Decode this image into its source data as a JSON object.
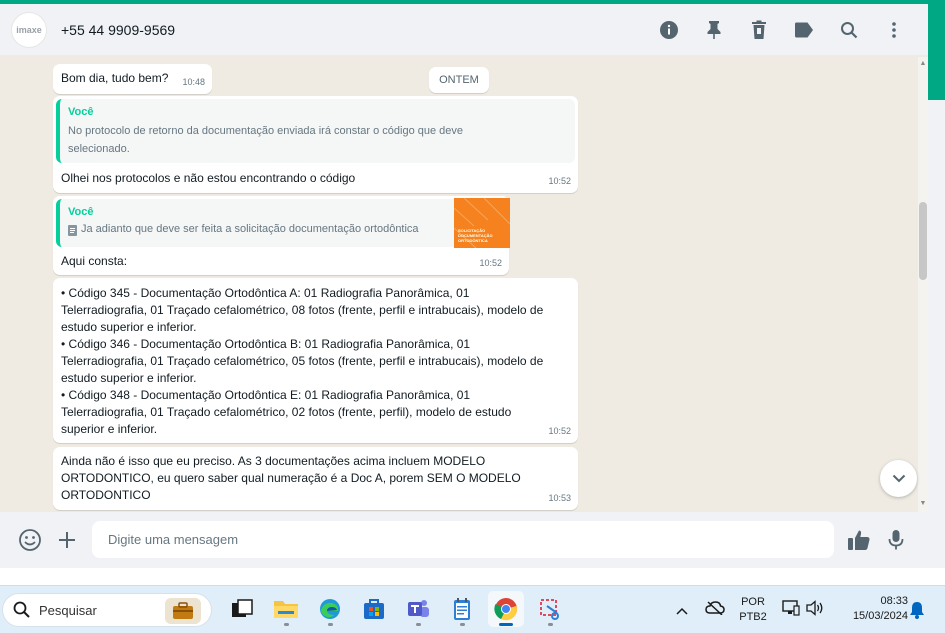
{
  "header": {
    "avatar_text": "imaxe",
    "contact": "+55 44 9909-9569",
    "icons": [
      "info-icon",
      "pin-icon",
      "delete-icon",
      "label-icon",
      "search-icon",
      "menu-icon"
    ]
  },
  "chat": {
    "date_chip": "ONTEM",
    "messages": [
      {
        "text": "Bom dia, tudo bem?",
        "time": "10:48"
      },
      {
        "quote_author": "Você",
        "quote_text_1": "No protocolo de retorno da documentação enviada irá constar o código que deve",
        "quote_text_2": "selecionado.",
        "text": "Olhei nos protocolos e não estou encontrando o código",
        "time": "10:52"
      },
      {
        "quote_author": "Você",
        "quote_text": "Ja adianto que deve ser feita a solicitação documentação ortodôntica",
        "thumb_text": "SOLICITAÇÃO DOCUMENTAÇÃO ORTODÔNTICA",
        "text": "Aqui consta:",
        "time": "10:52"
      },
      {
        "lines": [
          "• Código 345 - Documentação Ortodôntica A: 01 Radiografia Panorâmica, 01",
          "Telerradiografia, 01 Traçado cefalométrico, 08 fotos (frente, perfil e intrabucais), modelo de",
          "estudo superior e inferior.",
          "• Código 346 - Documentação Ortodôntica B: 01 Radiografia Panorâmica, 01",
          "Telerradiografia, 01 Traçado cefalométrico, 05 fotos (frente, perfil e intrabucais), modelo de",
          "estudo superior e inferior.",
          "• Código 348 - Documentação Ortodôntica E: 01 Radiografia Panorâmica, 01",
          "Telerradiografia, 01 Traçado cefalométrico, 02 fotos (frente, perfil), modelo de estudo",
          "superior e inferior."
        ],
        "time": "10:52"
      },
      {
        "lines": [
          "Ainda não é isso que eu preciso. As 3 documentações acima incluem MODELO",
          "ORTODONTICO, eu quero saber qual numeração é a Doc A, porem SEM O MODELO",
          "ORTODONTICO"
        ],
        "time": "10:53"
      }
    ]
  },
  "composer": {
    "placeholder": "Digite uma mensagem"
  },
  "taskbar": {
    "search_placeholder": "Pesquisar",
    "lang_1": "POR",
    "lang_2": "PTB2",
    "time": "08:33",
    "date": "15/03/2024"
  },
  "colors": {
    "accent": "#00a884",
    "quote_bar": "#06cf9c",
    "chat_bg": "#efeae2"
  }
}
